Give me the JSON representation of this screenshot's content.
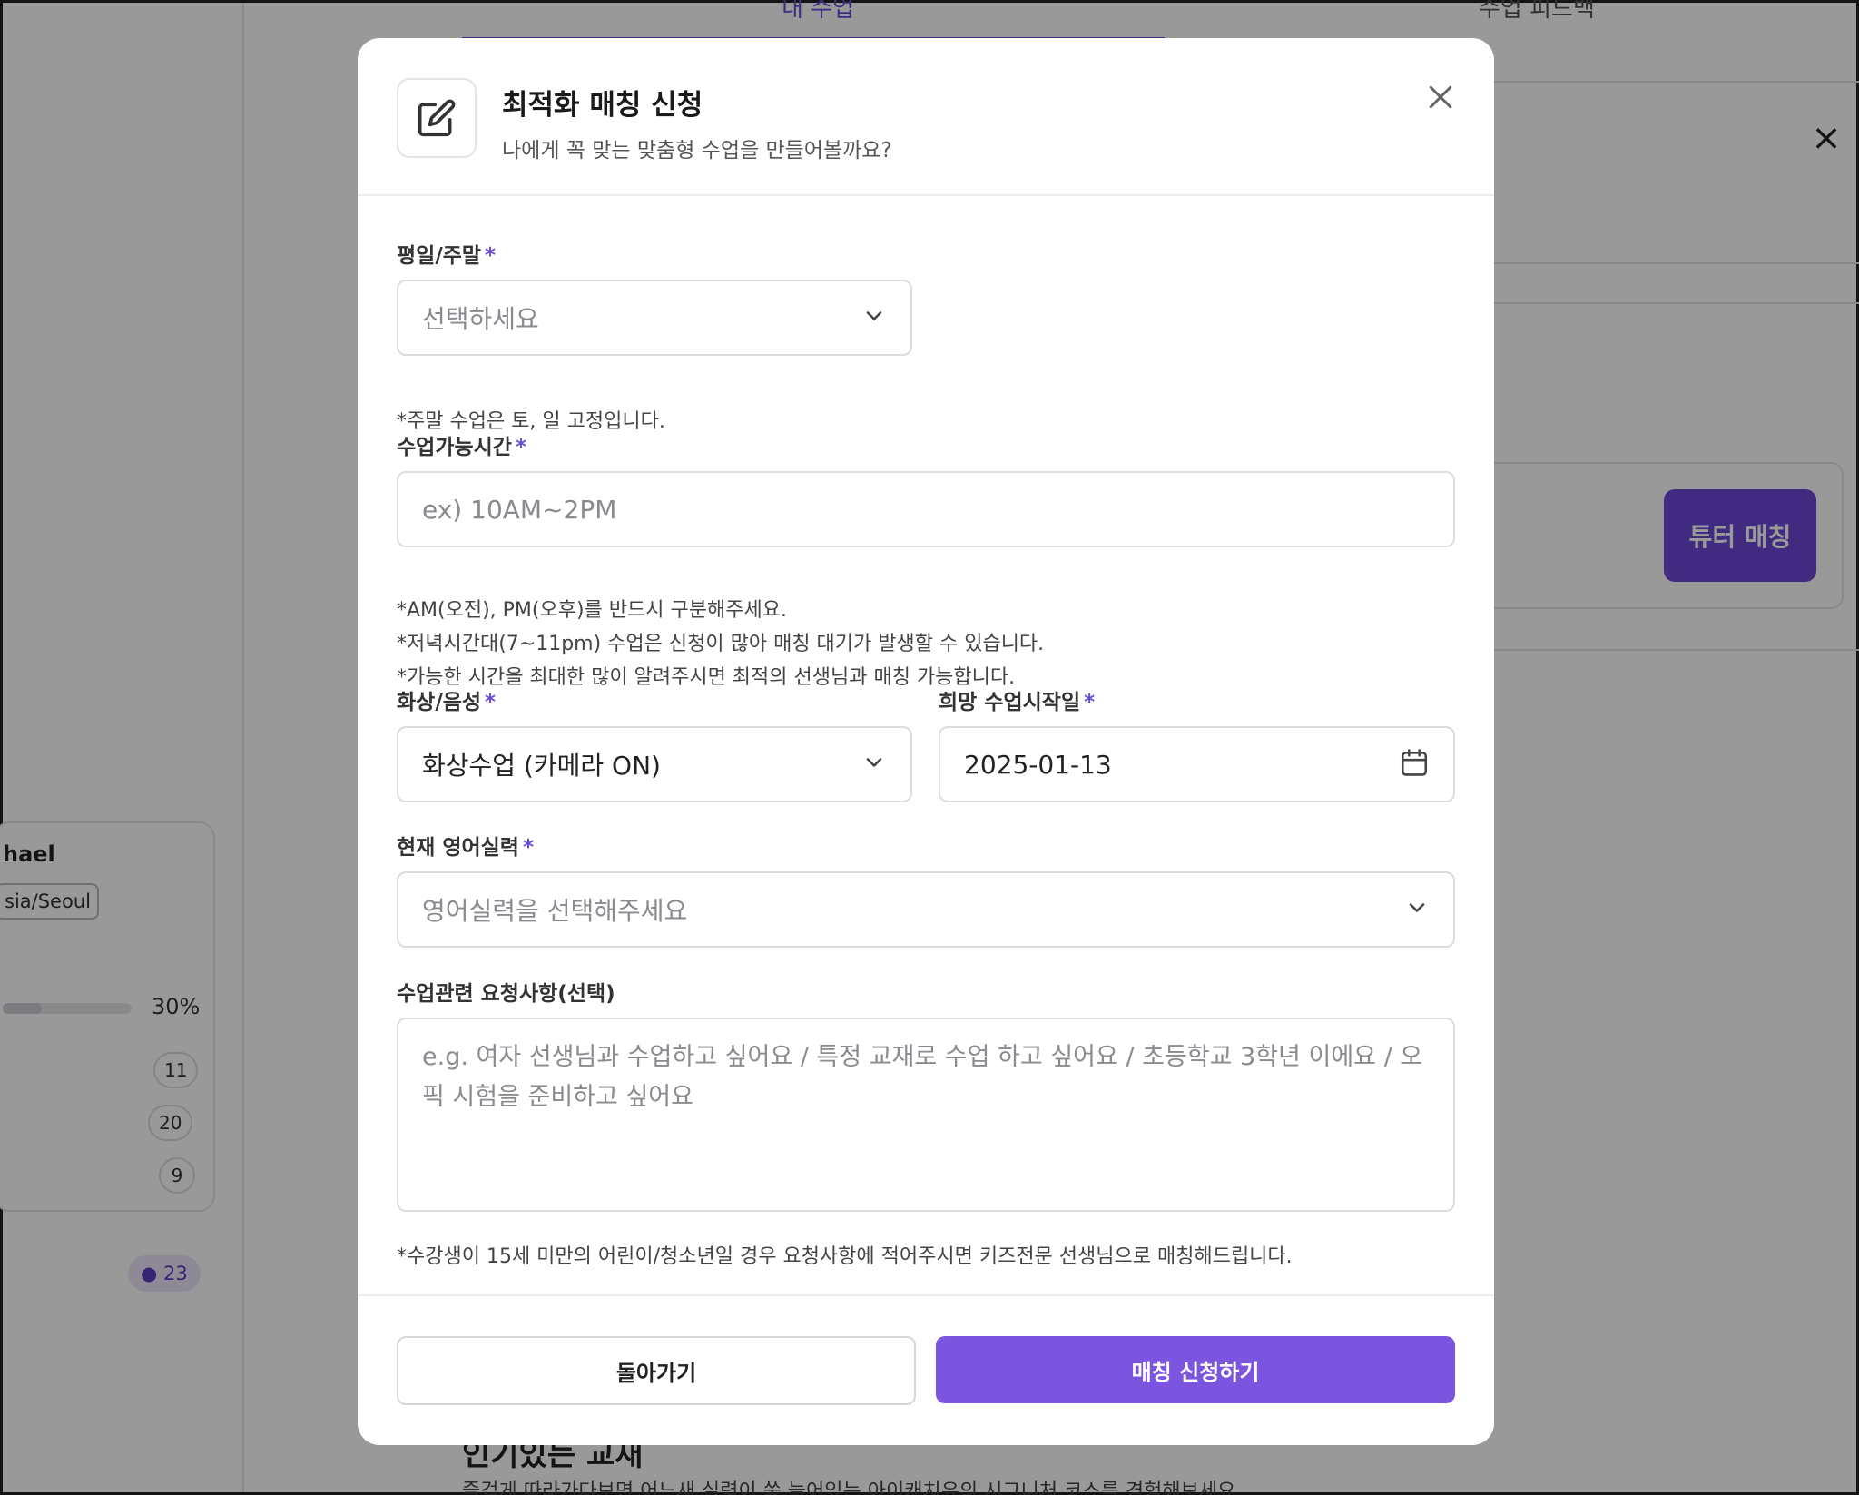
{
  "background": {
    "tabs": [
      "내 수업",
      "수업 피드백"
    ],
    "tutor_button": "튜터 매칭",
    "profile_name": "hael",
    "timezone": "sia/Seoul",
    "progress_label": "30%",
    "progress": 0.3,
    "counts": [
      "11",
      "20",
      "9"
    ],
    "badge": "● 23",
    "bottom_title": "인기있는 교재",
    "bottom_text": "즐겁게 따라가다보면 어느새 실력이 쑥 늘어있는 아이캐치유의 시그니처 코스를 경험해보세요"
  },
  "modal": {
    "title": "최적화 매칭 신청",
    "subtitle": "나에게 꼭 맞는 맞춤형 수업을 만들어볼까요?",
    "fields": {
      "weekday": {
        "label": "평일/주말",
        "required_mark": "*",
        "placeholder": "선택하세요",
        "note": "*주말 수업은 토, 일 고정입니다."
      },
      "time": {
        "label": "수업가능시간",
        "required_mark": "*",
        "placeholder": "ex) 10AM~2PM",
        "notes": [
          "*AM(오전), PM(오후)를 반드시 구분해주세요.",
          "*저녁시간대(7~11pm) 수업은 신청이 많아 매칭 대기가 발생할 수 있습니다.",
          "*가능한 시간을 최대한 많이 알려주시면 최적의 선생님과 매칭 가능합니다."
        ]
      },
      "video": {
        "label": "화상/음성",
        "required_mark": "*",
        "value": "화상수업 (카메라 ON)"
      },
      "start_date": {
        "label": "희망 수업시작일",
        "required_mark": "*",
        "value": "2025-01-13"
      },
      "level": {
        "label": "현재 영어실력",
        "required_mark": "*",
        "placeholder": "영어실력을 선택해주세요"
      },
      "request": {
        "label": "수업관련 요청사항(선택)",
        "placeholder": "e.g. 여자 선생님과 수업하고 싶어요 / 특정 교재로 수업 하고 싶어요 / 초등학교 3학년 이에요 / 오픽 시험을 준비하고 싶어요",
        "note": "*수강생이 15세 미만의 어린이/청소년일 경우 요청사항에 적어주시면 키즈전문 선생님으로 매칭해드립니다."
      }
    },
    "buttons": {
      "back": "돌아가기",
      "submit": "매칭 신청하기"
    }
  }
}
